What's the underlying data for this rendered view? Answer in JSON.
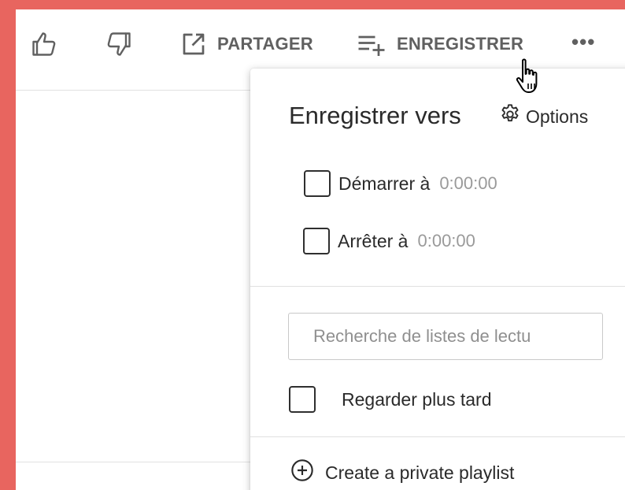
{
  "toolbar": {
    "like_icon": "thumbs-up-icon",
    "dislike_icon": "thumbs-down-icon",
    "share_icon": "share-icon",
    "share_label": "PARTAGER",
    "save_icon": "playlist-add-icon",
    "save_label": "ENREGISTRER",
    "more_label": "•••"
  },
  "panel": {
    "title": "Enregistrer vers",
    "options_icon": "gear-icon",
    "options_label": "Options",
    "start": {
      "label": "Démarrer à",
      "time": "0:00:00",
      "checked": false
    },
    "stop": {
      "label": "Arrêter à",
      "time": "0:00:00",
      "checked": false
    },
    "search_placeholder": "Recherche de listes de lectu",
    "search_value": "",
    "playlists": [
      {
        "label": "Regarder plus tard",
        "checked": false
      }
    ],
    "create_icon": "plus-circle-icon",
    "create_label": "Create a private playlist"
  },
  "colors": {
    "frame_border": "#e8655f",
    "toolbar_text": "#606060",
    "text": "#2a2a2a",
    "muted": "#9a9a9a"
  }
}
